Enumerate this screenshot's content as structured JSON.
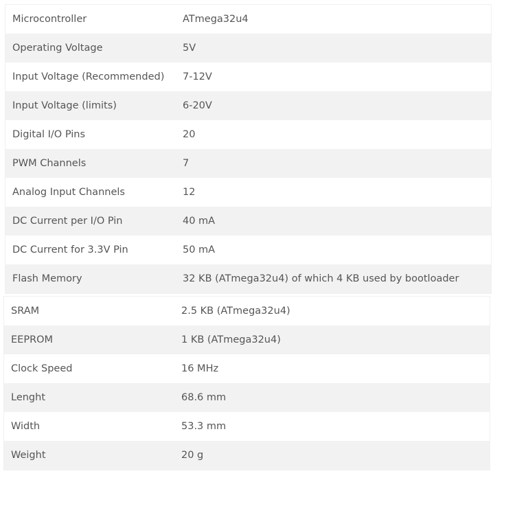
{
  "specs_table_1": [
    {
      "label": "Microcontroller",
      "value": "ATmega32u4"
    },
    {
      "label": "Operating Voltage",
      "value": "5V"
    },
    {
      "label": "Input Voltage (Recommended)",
      "value": "7-12V"
    },
    {
      "label": "Input Voltage (limits)",
      "value": "6-20V"
    },
    {
      "label": "Digital I/O Pins",
      "value": "20"
    },
    {
      "label": "PWM Channels",
      "value": "7"
    },
    {
      "label": "Analog Input Channels",
      "value": "12"
    },
    {
      "label": "DC Current per I/O Pin",
      "value": "40 mA"
    },
    {
      "label": "DC Current for 3.3V Pin",
      "value": "50 mA"
    },
    {
      "label": "Flash Memory",
      "value": "32 KB (ATmega32u4) of which 4 KB used by bootloader"
    }
  ],
  "specs_table_2": [
    {
      "label": "SRAM",
      "value": "2.5 KB (ATmega32u4)"
    },
    {
      "label": "EEPROM",
      "value": "1 KB (ATmega32u4)"
    },
    {
      "label": "Clock Speed",
      "value": "16 MHz"
    },
    {
      "label": "Lenght",
      "value": "68.6 mm"
    },
    {
      "label": "Width",
      "value": "53.3 mm"
    },
    {
      "label": "Weight",
      "value": "20 g"
    }
  ]
}
